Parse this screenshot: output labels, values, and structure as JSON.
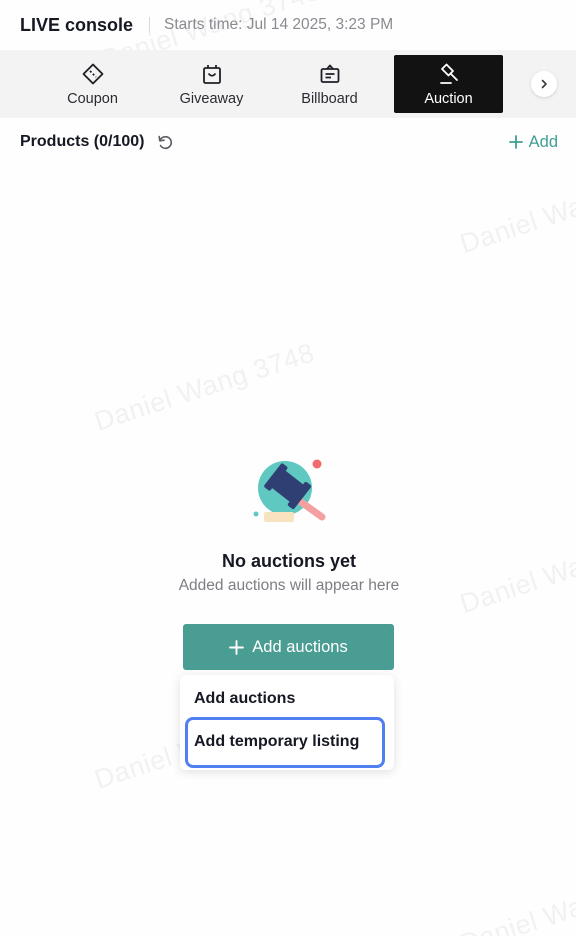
{
  "header": {
    "title": "LIVE console",
    "starts_label": "Starts time: Jul 14 2025, 3:23 PM"
  },
  "tabs": [
    {
      "label": "Coupon",
      "icon": "coupon-icon",
      "active": false
    },
    {
      "label": "Giveaway",
      "icon": "giveaway-icon",
      "active": false
    },
    {
      "label": "Billboard",
      "icon": "billboard-icon",
      "active": false
    },
    {
      "label": "Auction",
      "icon": "auction-icon",
      "active": true
    }
  ],
  "products": {
    "label": "Products (0/100)",
    "add_label": "Add"
  },
  "empty_state": {
    "title": "No auctions yet",
    "subtitle": "Added auctions will appear here",
    "button_label": "Add auctions"
  },
  "dropdown": {
    "items": [
      "Add auctions",
      "Add temporary listing"
    ],
    "highlighted_item": "Add temporary listing"
  },
  "watermark": {
    "text_full": "Daniel Wang 3748",
    "text_partial": "Daniel Wa",
    "text_partial_short": "Daniel W"
  },
  "colors": {
    "accent": "#4a9d93",
    "accent_text": "#3f9e95",
    "active_tab_bg": "#121212",
    "highlight_border": "#4f7ff0",
    "illustration_circle": "#5fc8c0",
    "gavel": "#2f3e73",
    "dot": "#f06b6b"
  }
}
